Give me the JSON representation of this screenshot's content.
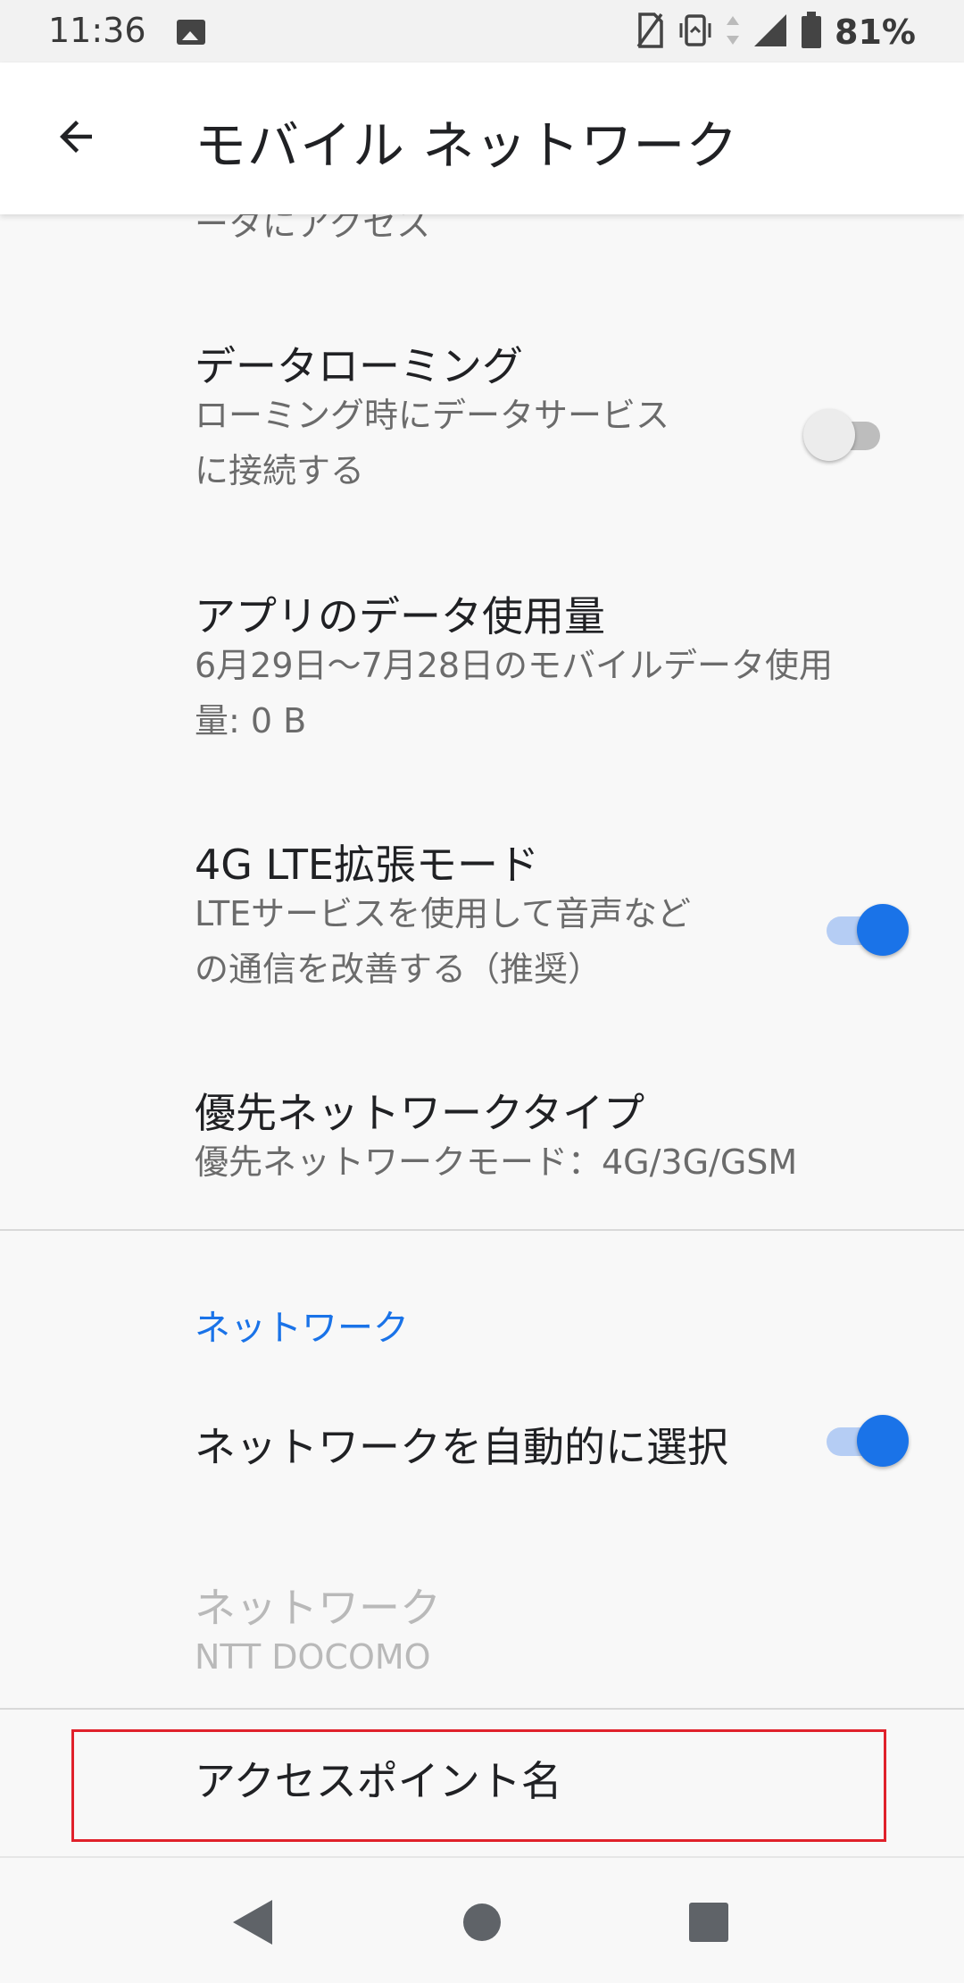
{
  "status_bar": {
    "time": "11:36",
    "battery_percent": "81%",
    "icons": [
      "image-icon",
      "sim-off-icon",
      "vibrate-icon",
      "data-arrows-icon",
      "signal-icon",
      "battery-icon"
    ]
  },
  "app_bar": {
    "back_icon": "arrow-back-icon",
    "title": "モバイル ネットワーク"
  },
  "items": {
    "partial_top": {
      "subtitle": "ータにアクセス"
    },
    "data_roaming": {
      "title": "データローミング",
      "subtitle_line1": "ローミング時にデータサービス",
      "subtitle_line2": "に接続する",
      "enabled": false
    },
    "app_data_usage": {
      "title": "アプリのデータ使用量",
      "subtitle_line1": "6月29日〜7月28日のモバイルデータ使用",
      "subtitle_line2": "量: 0 B"
    },
    "lte_mode": {
      "title": "4G LTE拡張モード",
      "subtitle_line1": "LTEサービスを使用して音声など",
      "subtitle_line2": "の通信を改善する（推奨）",
      "enabled": true
    },
    "preferred_network": {
      "title": "優先ネットワークタイプ",
      "subtitle": "優先ネットワークモード：4G/3G/GSM"
    }
  },
  "network_section": {
    "header": "ネットワーク",
    "auto_select": {
      "title": "ネットワークを自動的に選択",
      "enabled": true
    },
    "network": {
      "title": "ネットワーク",
      "subtitle": "NTT DOCOMO"
    }
  },
  "access_point": {
    "title": "アクセスポイント名"
  },
  "nav_bar": {
    "buttons": [
      "back-triangle-icon",
      "home-circle-icon",
      "recents-square-icon"
    ]
  },
  "colors": {
    "accent": "#1a73e8",
    "highlight": "#e0212b",
    "background": "#f8f8f8"
  }
}
